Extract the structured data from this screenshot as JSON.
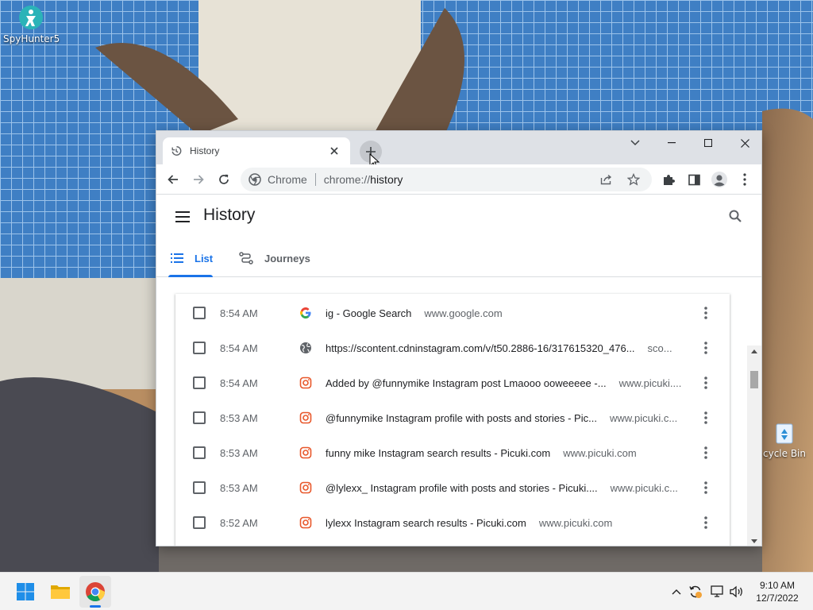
{
  "desktop": {
    "icons": [
      {
        "label": "SpyHunter5",
        "icon": "spyhunter-icon"
      },
      {
        "label": "cycle Bin",
        "icon": "recycle-bin-icon"
      }
    ]
  },
  "browser": {
    "tab_title": "History",
    "omnibox": {
      "chip": "Chrome",
      "url_scheme": "chrome://",
      "url_host": "history"
    }
  },
  "history_page": {
    "title": "History",
    "tabs": [
      {
        "label": "List",
        "active": true,
        "icon": "list-icon"
      },
      {
        "label": "Journeys",
        "active": false,
        "icon": "journeys-icon"
      }
    ],
    "rows": [
      {
        "time": "8:54 AM",
        "favicon": "google-favicon",
        "title": "ig - Google Search",
        "domain": "www.google.com"
      },
      {
        "time": "8:54 AM",
        "favicon": "globe-favicon",
        "title": "https://scontent.cdninstagram.com/v/t50.2886-16/317615320_476...",
        "domain": "sco..."
      },
      {
        "time": "8:54 AM",
        "favicon": "picuki-favicon",
        "title": "Added by @funnymike Instagram post Lmaooo ooweeeee -...",
        "domain": "www.picuki...."
      },
      {
        "time": "8:53 AM",
        "favicon": "picuki-favicon",
        "title": "@funnymike Instagram profile with posts and stories - Pic...",
        "domain": "www.picuki.c..."
      },
      {
        "time": "8:53 AM",
        "favicon": "picuki-favicon",
        "title": "funny mike Instagram search results - Picuki.com",
        "domain": "www.picuki.com"
      },
      {
        "time": "8:53 AM",
        "favicon": "picuki-favicon",
        "title": "@lylexx_ Instagram profile with posts and stories - Picuki....",
        "domain": "www.picuki.c..."
      },
      {
        "time": "8:52 AM",
        "favicon": "picuki-favicon",
        "title": "lylexx Instagram search results - Picuki.com",
        "domain": "www.picuki.com"
      }
    ]
  },
  "taskbar": {
    "clock_time": "9:10 AM",
    "clock_date": "12/7/2022"
  },
  "colors": {
    "accent": "#1a73e8",
    "tabstrip": "#dee1e6",
    "picuki": "#e8572a"
  }
}
